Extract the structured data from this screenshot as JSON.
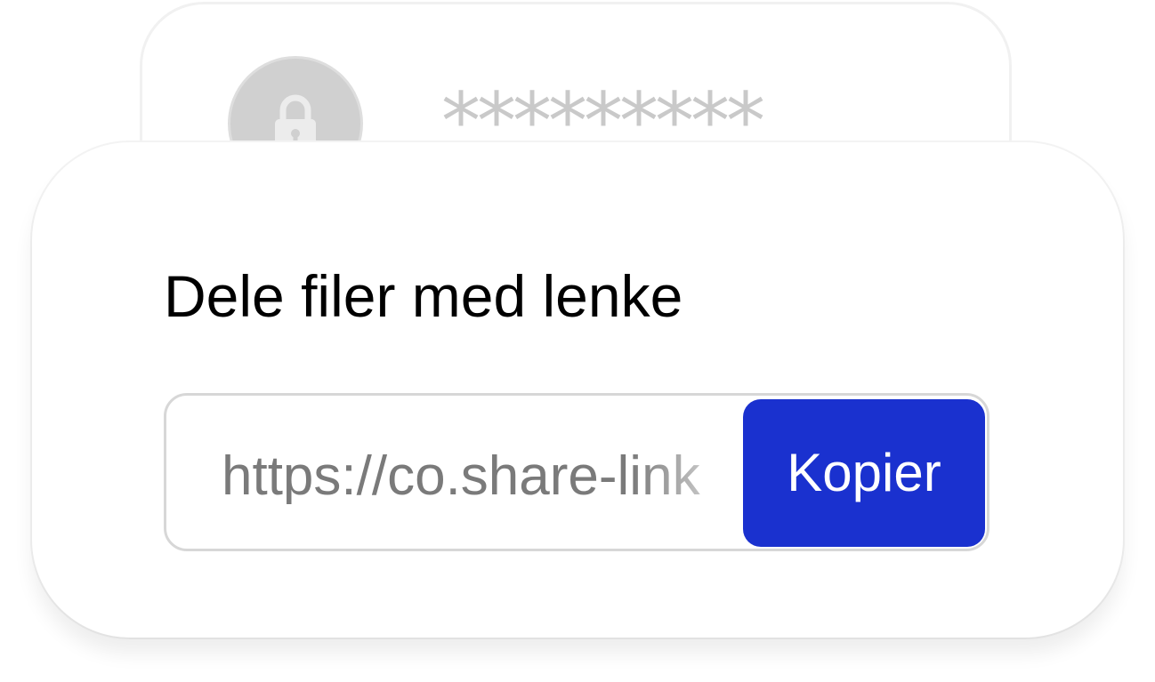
{
  "password_card": {
    "icon": "lock-icon",
    "masked_value": "*********"
  },
  "share_card": {
    "title": "Dele filer med lenke",
    "link_value": "https://co.share-link",
    "copy_label": "Kopier",
    "accent_color": "#1a31cf"
  }
}
